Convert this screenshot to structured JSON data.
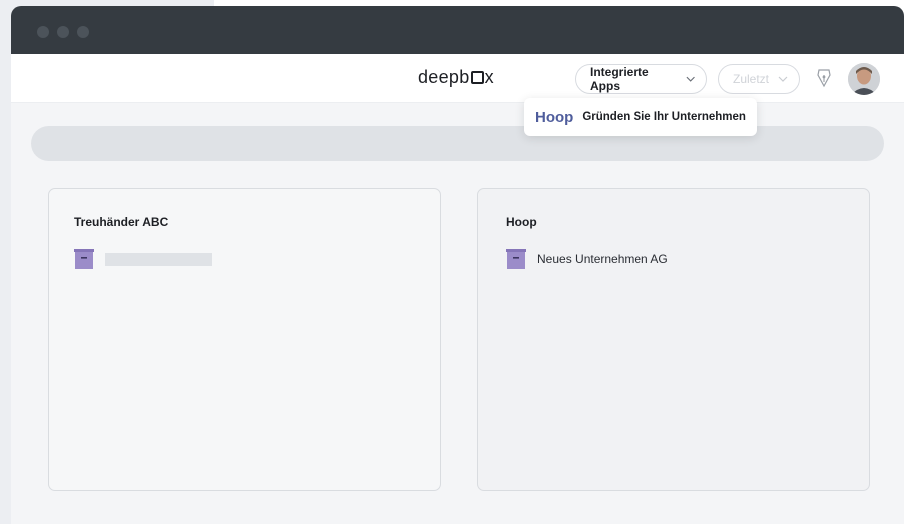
{
  "header": {
    "logo": "deepbox",
    "integrated_apps_label": "Integrierte Apps",
    "recent_label": "Zuletzt"
  },
  "popover": {
    "brand": "Hoop",
    "text": "Gründen Sie Ihr Unternehmen"
  },
  "cards": [
    {
      "title": "Treuhänder ABC",
      "item_label": ""
    },
    {
      "title": "Hoop",
      "item_label": "Neues Unternehmen AG"
    }
  ],
  "colors": {
    "accent": "#4f5d9c",
    "box_icon": "#9b8cc9",
    "titlebar": "#353b41"
  }
}
